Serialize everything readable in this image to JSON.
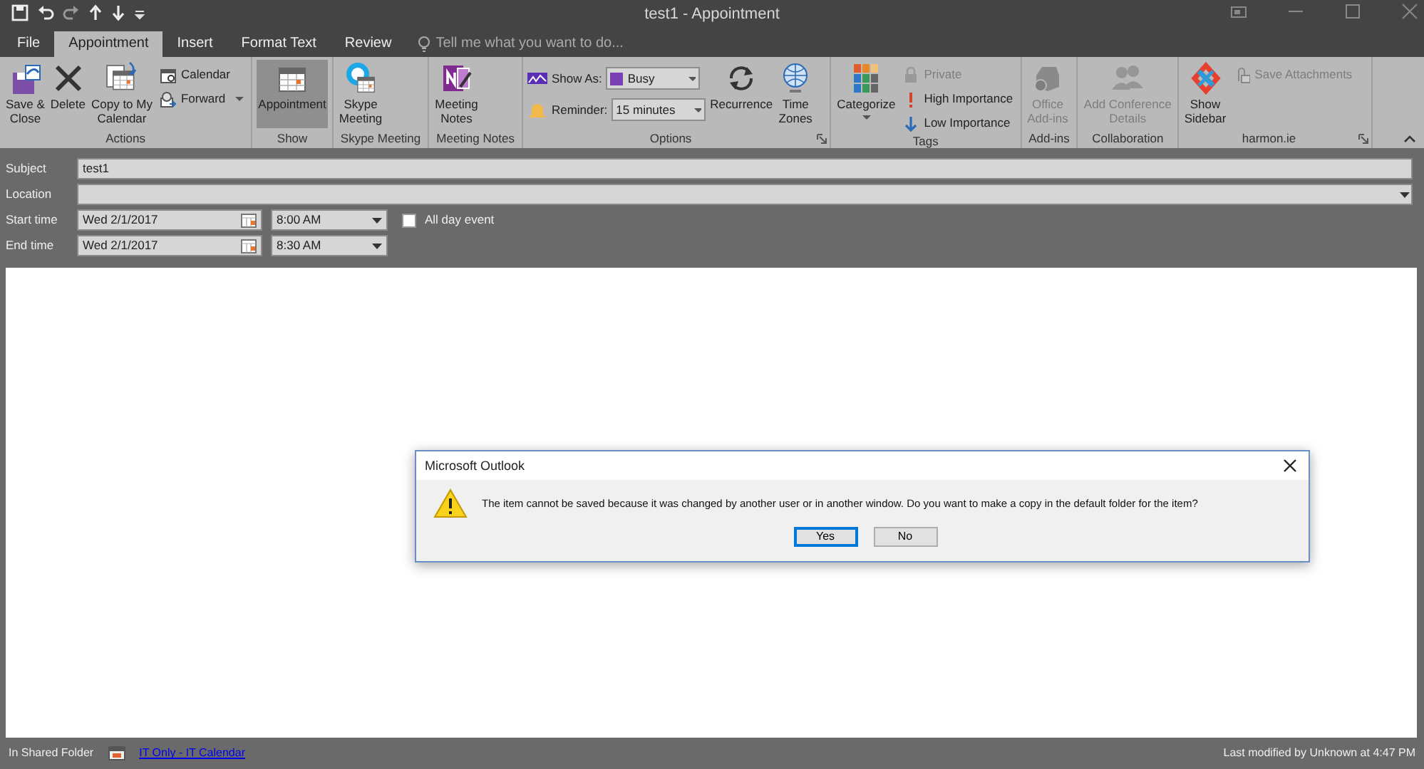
{
  "window": {
    "title": "test1 - Appointment"
  },
  "tabs": [
    {
      "label": "File",
      "selected": false
    },
    {
      "label": "Appointment",
      "selected": true
    },
    {
      "label": "Insert",
      "selected": false
    },
    {
      "label": "Format Text",
      "selected": false
    },
    {
      "label": "Review",
      "selected": false
    }
  ],
  "tell_me": {
    "placeholder": "Tell me what you want to do..."
  },
  "ribbon": {
    "groups": [
      {
        "label": "Actions",
        "items": [
          {
            "kind": "large",
            "lines": [
              "Save &",
              "Close"
            ],
            "disabled": false,
            "selected": false
          },
          {
            "kind": "large",
            "lines": [
              "Delete"
            ],
            "disabled": false,
            "selected": false
          },
          {
            "kind": "large",
            "lines": [
              "Copy to My",
              "Calendar"
            ],
            "disabled": false,
            "selected": false
          },
          {
            "kind": "small",
            "label": "Calendar",
            "disabled": false
          },
          {
            "kind": "small",
            "label": "Forward",
            "disabled": false,
            "caret": true
          }
        ]
      },
      {
        "label": "Show",
        "items": [
          {
            "kind": "large",
            "lines": [
              "Appointment"
            ],
            "disabled": false,
            "selected": true
          }
        ]
      },
      {
        "label": "Skype Meeting",
        "items": [
          {
            "kind": "large",
            "lines": [
              "Skype",
              "Meeting"
            ],
            "disabled": false,
            "selected": false
          }
        ]
      },
      {
        "label": "Meeting Notes",
        "items": [
          {
            "kind": "large",
            "lines": [
              "Meeting",
              "Notes"
            ],
            "disabled": false,
            "selected": false
          }
        ]
      },
      {
        "label": "Options",
        "launcher": true,
        "items": [
          {
            "kind": "dropdown",
            "label": "Show As:",
            "value": "Busy",
            "color": "#7b3fb5"
          },
          {
            "kind": "dropdown",
            "label": "Reminder:",
            "value": "15 minutes"
          },
          {
            "kind": "large",
            "lines": [
              "Recurrence"
            ],
            "disabled": false,
            "selected": false
          },
          {
            "kind": "large",
            "lines": [
              "Time",
              "Zones"
            ],
            "disabled": false,
            "selected": false
          }
        ]
      },
      {
        "label": "Tags",
        "items": [
          {
            "kind": "large",
            "lines": [
              "Categorize"
            ],
            "disabled": false,
            "selected": false,
            "caret": true
          },
          {
            "kind": "small",
            "label": "Private",
            "disabled": true
          },
          {
            "kind": "small",
            "label": "High Importance",
            "disabled": false
          },
          {
            "kind": "small",
            "label": "Low Importance",
            "disabled": false
          }
        ]
      },
      {
        "label": "Add-ins",
        "items": [
          {
            "kind": "large",
            "lines": [
              "Office",
              "Add-ins"
            ],
            "disabled": true,
            "selected": false
          }
        ]
      },
      {
        "label": "Collaboration",
        "items": [
          {
            "kind": "large",
            "lines": [
              "Add Conference",
              "Details"
            ],
            "disabled": true,
            "selected": false
          }
        ]
      },
      {
        "label": "harmon.ie",
        "launcher": true,
        "items": [
          {
            "kind": "large",
            "lines": [
              "Show",
              "Sidebar"
            ],
            "disabled": false,
            "selected": false
          },
          {
            "kind": "small",
            "label": "Save Attachments",
            "disabled": true
          }
        ]
      }
    ]
  },
  "form": {
    "subject": {
      "label": "Subject",
      "value": "test1"
    },
    "location": {
      "label": "Location"
    },
    "rows": [
      {
        "label": "Start time",
        "date": "Wed 2/1/2017",
        "time": "8:00 AM"
      },
      {
        "label": "End time",
        "date": "Wed 2/1/2017",
        "time": "8:30 AM"
      }
    ],
    "all_day": {
      "label": "All day event",
      "checked": false
    }
  },
  "dialog": {
    "title": "Microsoft Outlook",
    "message": "The item cannot be saved because it was changed by another user or in another window. Do you want to make a copy in the default folder for the item?",
    "buttons": [
      {
        "label": "Yes",
        "selected": true
      },
      {
        "label": "No",
        "selected": false
      }
    ]
  },
  "status_bar": {
    "folder": "In Shared Folder",
    "link": "IT Only - IT Calendar",
    "modified": "Last modified by Unknown at 4:47 PM"
  }
}
